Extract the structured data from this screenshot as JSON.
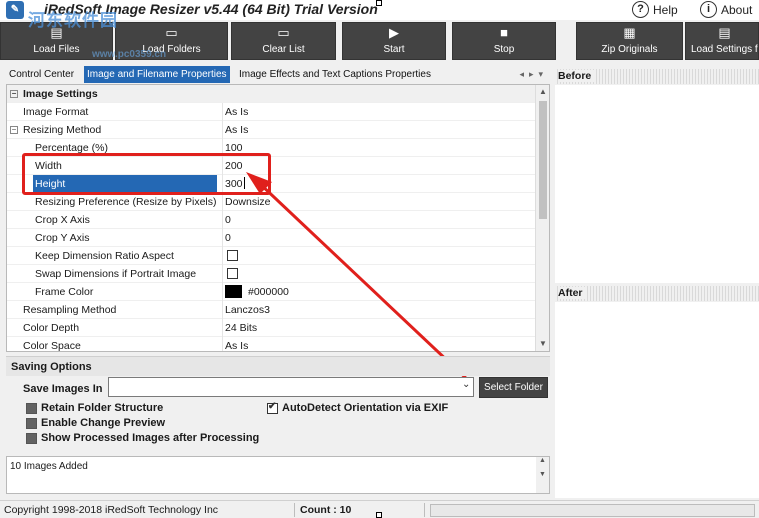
{
  "window": {
    "title": "iRedSoft Image Resizer v5.44 (64 Bit) Trial Version",
    "help_label": "Help",
    "about_label": "About",
    "watermark": "河东软件园",
    "watermark_url": "www.pc0359.cn"
  },
  "toolbar": {
    "load_files": "Load Files",
    "load_folders": "Load Folders",
    "clear_list": "Clear List",
    "start": "Start",
    "stop": "Stop",
    "zip_originals": "Zip Originals",
    "load_settings": "Load Settings f"
  },
  "tabs": [
    {
      "label": "Control Center"
    },
    {
      "label": "Image and Filename Properties",
      "active": true
    },
    {
      "label": "Image Effects and Text Captions Properties"
    }
  ],
  "grid": {
    "category": "Image Settings",
    "rows": [
      {
        "name": "Image Format",
        "value": "As Is"
      },
      {
        "name": "Resizing Method",
        "value": "As Is"
      },
      {
        "name": "Percentage (%)",
        "value": "100"
      },
      {
        "name": "Width",
        "value": "200"
      },
      {
        "name": "Height",
        "value": "300"
      },
      {
        "name": "Resizing Preference (Resize by Pixels)",
        "value": "Downsize"
      },
      {
        "name": "Crop X Axis",
        "value": "0"
      },
      {
        "name": "Crop Y Axis",
        "value": "0"
      },
      {
        "name": "Keep Dimension Ratio Aspect",
        "value": "",
        "checked": false
      },
      {
        "name": "Swap Dimensions if Portrait Image",
        "value": "",
        "checked": false
      },
      {
        "name": "Frame Color",
        "value": "#000000"
      },
      {
        "name": "Resampling Method",
        "value": "Lanczos3"
      },
      {
        "name": "Color Depth",
        "value": "24 Bits"
      },
      {
        "name": "Color Space",
        "value": "As Is"
      }
    ]
  },
  "saving": {
    "title": "Saving Options",
    "save_images_in": "Save Images In",
    "folder_value": "",
    "select_folder": "Select Folder",
    "options": [
      {
        "label": "Retain Folder Structure",
        "checked": false
      },
      {
        "label": "Enable Change Preview",
        "checked": false
      },
      {
        "label": "Show Processed Images after Processing",
        "checked": false
      },
      {
        "label": "AutoDetect Orientation via EXIF",
        "checked": true
      }
    ]
  },
  "log": {
    "text": "10 Images Added"
  },
  "preview": {
    "before": "Before",
    "after": "After"
  },
  "status": {
    "copyright": "Copyright 1998-2018 iRedSoft Technology Inc",
    "count": "Count : 10"
  },
  "colors": {
    "accent": "#2468b4",
    "toolbar_button": "#434343",
    "annotation": "#e0201c"
  },
  "icons": [
    "folder-icon",
    "play-icon",
    "stop-icon",
    "zip-icon",
    "question-icon",
    "info-icon"
  ]
}
